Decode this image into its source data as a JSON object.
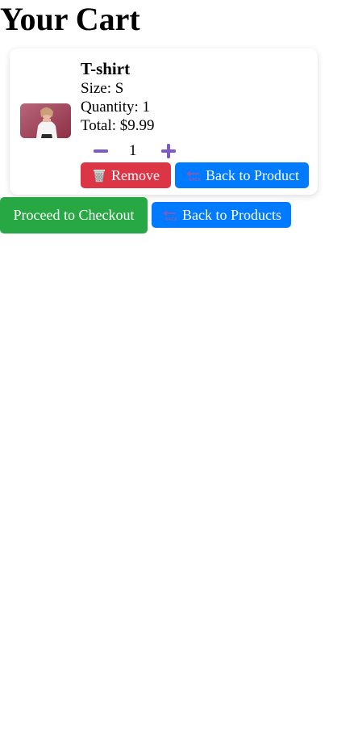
{
  "page": {
    "title": "Your Cart"
  },
  "cart": {
    "items": [
      {
        "name": "T-shirt",
        "size_line": "Size: S",
        "quantity_line": "Quantity: 1",
        "total_line": "Total: $9.99",
        "quantity_value": "1",
        "remove_label": "Remove",
        "back_to_product_label": "Back to Product"
      }
    ]
  },
  "actions": {
    "checkout_label": "Proceed to Checkout",
    "back_to_products_label": "Back to Products"
  },
  "colors": {
    "remove": "#dc3545",
    "primary": "#007bff",
    "checkout": "#28a745",
    "stepper_icon": "#7c5cc4"
  },
  "icons": {
    "minus": "minus-icon",
    "plus": "plus-icon",
    "trash": "wastebasket-icon",
    "back": "back-arrow-icon"
  }
}
